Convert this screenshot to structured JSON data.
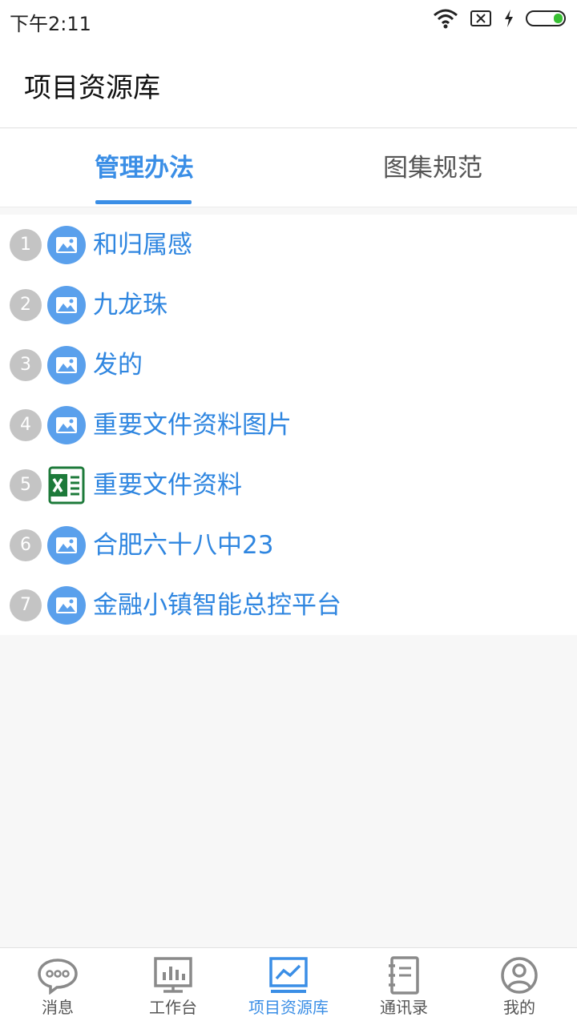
{
  "status": {
    "time": "下午2:11"
  },
  "header": {
    "title": "项目资源库"
  },
  "tabs": [
    {
      "label": "管理办法",
      "active": true
    },
    {
      "label": "图集规范",
      "active": false
    }
  ],
  "files": [
    {
      "index": "1",
      "name": "和归属感",
      "type": "image-icon"
    },
    {
      "index": "2",
      "name": "九龙珠",
      "type": "image-icon"
    },
    {
      "index": "3",
      "name": "发的",
      "type": "image-icon"
    },
    {
      "index": "4",
      "name": "重要文件资料图片",
      "type": "image-icon"
    },
    {
      "index": "5",
      "name": "重要文件资料",
      "type": "excel-icon"
    },
    {
      "index": "6",
      "name": "合肥六十八中23",
      "type": "image-icon"
    },
    {
      "index": "7",
      "name": "金融小镇智能总控平台",
      "type": "image-icon"
    }
  ],
  "nav": [
    {
      "label": "消息",
      "icon": "message-icon"
    },
    {
      "label": "工作台",
      "icon": "workbench-icon"
    },
    {
      "label": "项目资源库",
      "icon": "chart-icon",
      "active": true
    },
    {
      "label": "通讯录",
      "icon": "contacts-icon"
    },
    {
      "label": "我的",
      "icon": "profile-icon"
    }
  ],
  "colors": {
    "accent": "#3a8ee6",
    "link": "#2f86e0",
    "excel": "#1d7a3a"
  }
}
